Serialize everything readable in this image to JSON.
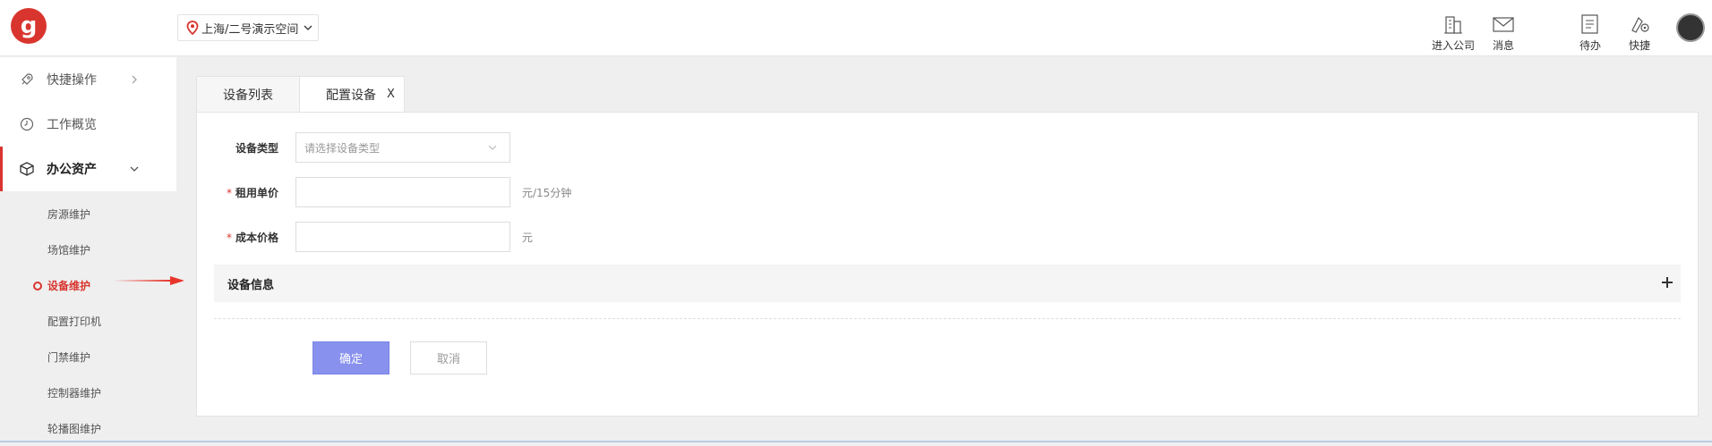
{
  "header": {
    "logo_letter": "g",
    "location": "上海/二号演示空间",
    "tools": [
      {
        "label": "进入公司",
        "icon": "building-icon"
      },
      {
        "label": "消息",
        "icon": "mail-icon"
      },
      {
        "label": "待办",
        "icon": "todo-icon"
      },
      {
        "label": "快捷",
        "icon": "shortcut-icon"
      }
    ]
  },
  "sidebar": {
    "items": [
      {
        "label": "快捷操作",
        "icon": "rocket-icon"
      },
      {
        "label": "工作概览",
        "icon": "clock-icon"
      },
      {
        "label": "办公资产",
        "icon": "box-icon"
      }
    ],
    "submenu": [
      {
        "label": "房源维护"
      },
      {
        "label": "场馆维护"
      },
      {
        "label": "设备维护"
      },
      {
        "label": "配置打印机"
      },
      {
        "label": "门禁维护"
      },
      {
        "label": "控制器维护"
      },
      {
        "label": "轮播图维护"
      }
    ]
  },
  "tabs": [
    {
      "label": "设备列表"
    },
    {
      "label": "配置设备",
      "close": "X"
    }
  ],
  "form": {
    "device_type": {
      "label": "设备类型",
      "placeholder": "请选择设备类型"
    },
    "rent_price": {
      "label": "租用单价",
      "required_mark": "*",
      "unit": "元/15分钟",
      "value": ""
    },
    "cost_price": {
      "label": "成本价格",
      "required_mark": "*",
      "unit": "元",
      "value": ""
    }
  },
  "section": {
    "title": "设备信息"
  },
  "buttons": {
    "ok": "确定",
    "cancel": "取消"
  },
  "colors": {
    "brand_red": "#d9352f",
    "primary_button": "#8891ee",
    "arrow": "#e8352b"
  }
}
